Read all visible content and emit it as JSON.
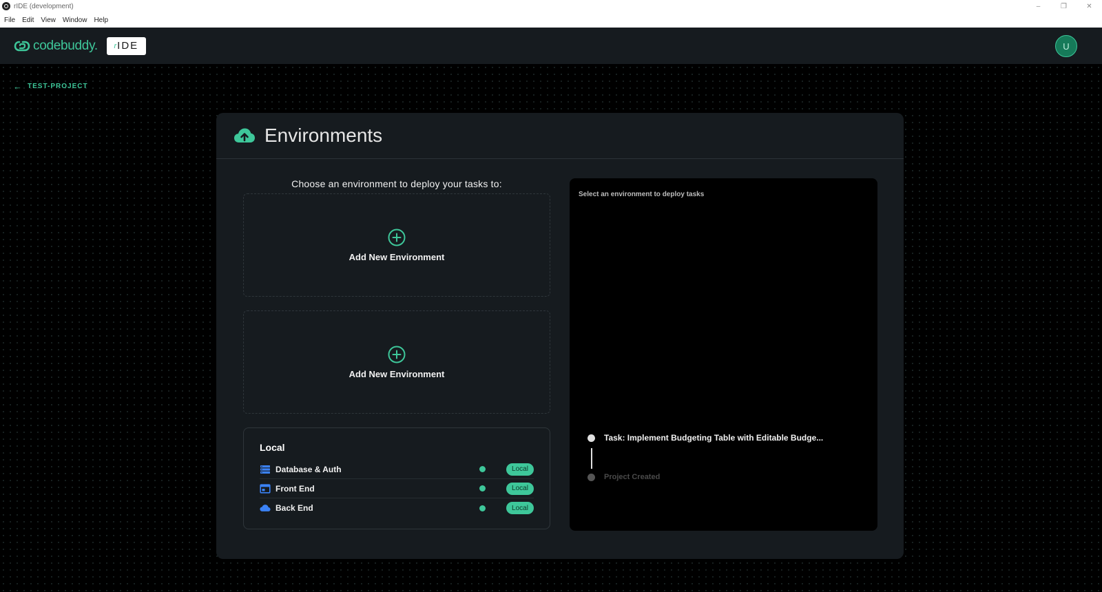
{
  "window": {
    "title": "rIDE (development)",
    "controls": {
      "minimize": "–",
      "restore": "❐",
      "close": "✕"
    }
  },
  "menubar": {
    "items": [
      "File",
      "Edit",
      "View",
      "Window",
      "Help"
    ]
  },
  "header": {
    "logo_text": "codebuddy.",
    "badge_prefix": "r",
    "badge_text": "IDE",
    "avatar_initial": "U"
  },
  "breadcrumb": {
    "label": "TEST-PROJECT"
  },
  "environments": {
    "title": "Environments",
    "prompt": "Choose an environment to deploy your tasks to:",
    "slots": [
      {
        "label": "Add New Environment"
      },
      {
        "label": "Add New Environment"
      }
    ],
    "local": {
      "title": "Local",
      "services": [
        {
          "name": "Database & Auth",
          "icon": "database-icon",
          "badge": "Local"
        },
        {
          "name": "Front End",
          "icon": "browser-window-icon",
          "badge": "Local"
        },
        {
          "name": "Back End",
          "icon": "cloud-icon",
          "badge": "Local"
        }
      ]
    }
  },
  "deploy_panel": {
    "hint": "Select an environment to deploy tasks",
    "timeline": {
      "task": "Task: Implement Budgeting Table with Editable Budge...",
      "created": "Project Created"
    }
  },
  "colors": {
    "accent": "#3ec79a",
    "card": "#161b1f",
    "background": "#000000",
    "service_icon": "#3b82f6"
  }
}
